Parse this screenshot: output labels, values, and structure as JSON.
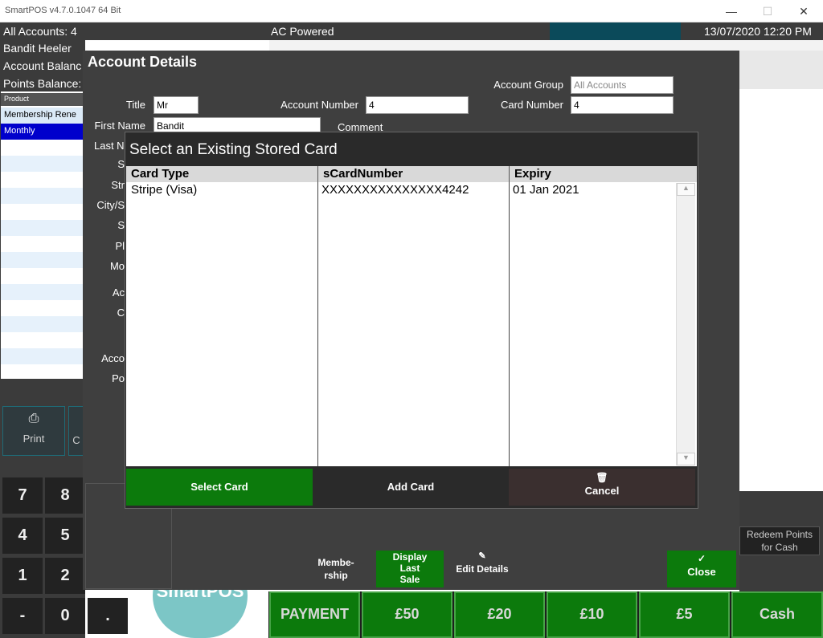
{
  "window": {
    "title": "SmartPOS v4.7.0.1047 64 Bit",
    "minimize": "—",
    "maximize": "☐",
    "close": "✕"
  },
  "statusbar": {
    "accounts": "All Accounts: 4",
    "power": "AC Powered",
    "datetime": "13/07/2020 12:20 PM",
    "accent": "#0b4a5a"
  },
  "left": {
    "lines": [
      "Bandit Heeler",
      "Account Balanc",
      "Points Balance:"
    ],
    "product_header": "Product",
    "rows": [
      "Membership Rene",
      "Monthly"
    ],
    "print_label": "Print",
    "print_icon": "printer-icon",
    "second_label": "C"
  },
  "keypad": {
    "keys": [
      "7",
      "8",
      "4",
      "5",
      "1",
      "2",
      "-",
      "0",
      "."
    ]
  },
  "account": {
    "heading": "Account Details",
    "title_label": "Title",
    "title_value": "Mr",
    "firstname_label": "First Name",
    "firstname_value": "Bandit",
    "lastname_label": "Last N",
    "acctnum_label": "Account Number",
    "acctnum_value": "4",
    "comment_label": "Comment",
    "group_label": "Account Group",
    "group_value": "All Accounts",
    "card_label": "Card Number",
    "card_value": "4",
    "partial_labels": [
      "S",
      "Str",
      "City/S",
      "S",
      "Pl",
      "Mo",
      "Ac",
      "C",
      "Acco",
      "Po"
    ]
  },
  "modal": {
    "title": "Select an Existing Stored Card",
    "columns": [
      "Card Type",
      "sCardNumber",
      "Expiry"
    ],
    "rows": [
      {
        "card_type": "Stripe (Visa)",
        "card_number": "XXXXXXXXXXXXXXX4242",
        "expiry": "01 Jan 2021"
      }
    ],
    "select_label": "Select Card",
    "add_label": "Add Card",
    "cancel_label": "Cancel",
    "cancel_icon": "trash-icon"
  },
  "actions": {
    "membership": "Membe-\nrship",
    "display_last_sale": "Display\nLast\nSale",
    "edit_details": "Edit Details",
    "edit_icon": "pencil-icon",
    "close": "Close",
    "close_icon": "check-icon",
    "redeem": "Redeem Points\nfor Cash"
  },
  "logo_text": "SmartPOS",
  "bottom": {
    "buttons": [
      "PAYMENT",
      "£50",
      "£20",
      "£10",
      "£5",
      "Cash"
    ]
  },
  "colors": {
    "green": "#0c7a0c",
    "dark": "#3f3f3f",
    "selected_row": "#0000cc",
    "cancel": "#3a2f2f"
  }
}
